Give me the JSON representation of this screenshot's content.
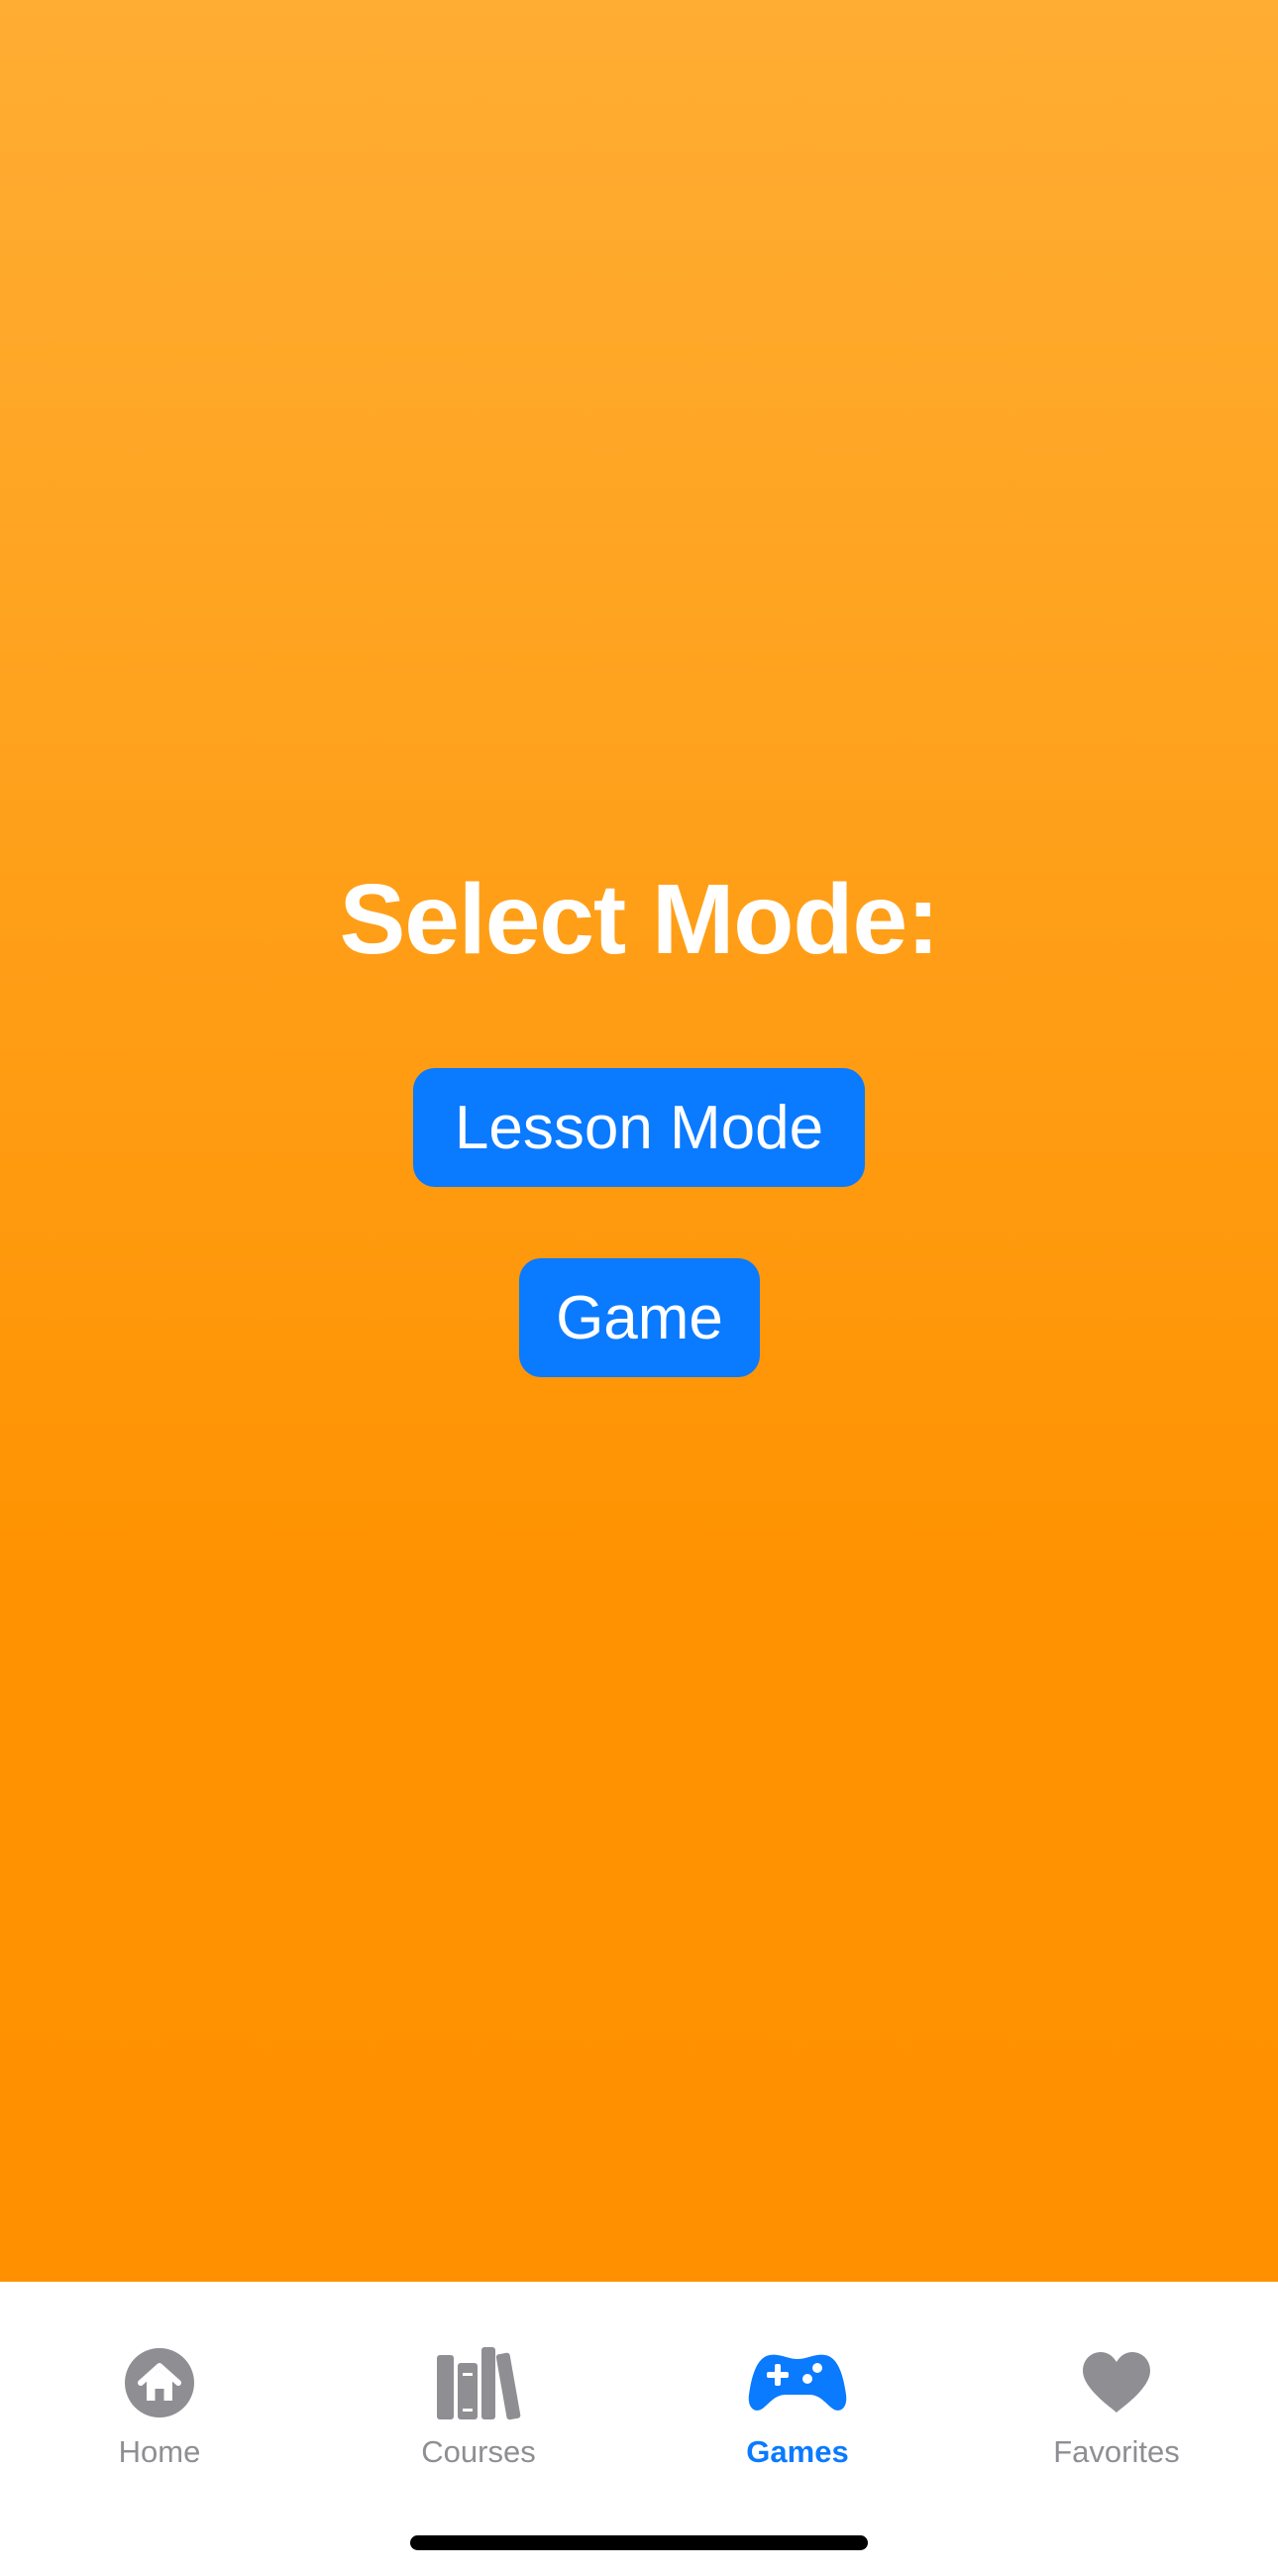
{
  "main": {
    "title": "Select Mode:",
    "buttons": {
      "lesson_mode": "Lesson Mode",
      "game": "Game"
    }
  },
  "tab_bar": {
    "items": [
      {
        "label": "Home",
        "icon": "house-icon",
        "active": false
      },
      {
        "label": "Courses",
        "icon": "books-icon",
        "active": false
      },
      {
        "label": "Games",
        "icon": "gamecontroller-icon",
        "active": true
      },
      {
        "label": "Favorites",
        "icon": "heart-icon",
        "active": false
      }
    ]
  },
  "colors": {
    "background_top": "#ffad33",
    "background_bottom": "#ff9100",
    "button": "#0a7aff",
    "tab_active": "#0a7aff",
    "tab_inactive": "#8e8e93"
  }
}
